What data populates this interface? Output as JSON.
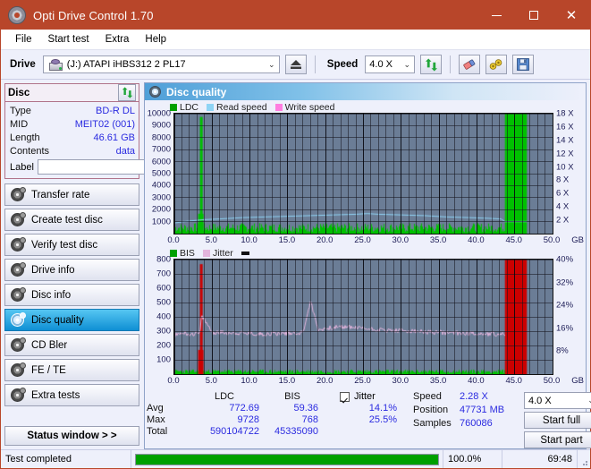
{
  "window": {
    "title": "Opti Drive Control 1.70",
    "icon": "disc-icon",
    "minimize": "–",
    "maximize": "□",
    "close": "✕"
  },
  "menubar": {
    "items": [
      "File",
      "Start test",
      "Extra",
      "Help"
    ]
  },
  "toolbar": {
    "drive_label": "Drive",
    "drive_value": "(J:)   ATAPI iHBS312  2 PL17",
    "eject_title": "eject-button",
    "speed_label": "Speed",
    "speed_value": "4.0 X",
    "buttons": [
      {
        "name": "refresh-icon",
        "glyph": "refresh"
      },
      {
        "name": "erase-icon",
        "glyph": "eraser"
      },
      {
        "name": "quick-erase-icon",
        "glyph": "wrench"
      },
      {
        "name": "save-icon",
        "glyph": "floppy"
      }
    ]
  },
  "disc_panel": {
    "title": "Disc",
    "refresh_icon": "refresh-icon",
    "rows": [
      {
        "key": "Type",
        "value": "BD-R DL"
      },
      {
        "key": "MID",
        "value": "MEIT02 (001)"
      },
      {
        "key": "Length",
        "value": "46.61 GB"
      },
      {
        "key": "Contents",
        "value": "data"
      }
    ],
    "label_key": "Label",
    "label_value": "",
    "label_placeholder": "",
    "label_button_icon": "disc-icon"
  },
  "sidebar": {
    "items": [
      {
        "label": "Transfer rate",
        "active": false
      },
      {
        "label": "Create test disc",
        "active": false
      },
      {
        "label": "Verify test disc",
        "active": false
      },
      {
        "label": "Drive info",
        "active": false
      },
      {
        "label": "Disc info",
        "active": false
      },
      {
        "label": "Disc quality",
        "active": true
      },
      {
        "label": "CD Bler",
        "active": false
      },
      {
        "label": "FE / TE",
        "active": false
      },
      {
        "label": "Extra tests",
        "active": false
      }
    ],
    "status_window": "Status window > >"
  },
  "quality_panel": {
    "title": "Disc quality",
    "icon": "disc-quality-icon"
  },
  "stats": {
    "col_headers": [
      "LDC",
      "BIS"
    ],
    "jitter_label": "Jitter",
    "jitter_checked": true,
    "rows": [
      {
        "key": "Avg",
        "ldc": "772.69",
        "bis": "59.36",
        "jitter": "14.1%"
      },
      {
        "key": "Max",
        "ldc": "9728",
        "bis": "768",
        "jitter": "25.5%"
      },
      {
        "key": "Total",
        "ldc": "590104722",
        "bis": "45335090",
        "jitter": ""
      }
    ]
  },
  "readout": {
    "speed_key": "Speed",
    "speed_value": "2.28 X",
    "speed_select": "4.0 X",
    "position_key": "Position",
    "position_value": "47731 MB",
    "samples_key": "Samples",
    "samples_value": "760086",
    "start_full": "Start full",
    "start_part": "Start part"
  },
  "statusbar": {
    "message": "Test completed",
    "percent_text": "100.0%",
    "percent_value": 100,
    "elapsed": "69:48"
  },
  "colors": {
    "ldc": "#00c000",
    "bis": "#00c000",
    "read_speed": "#8fd4f5",
    "write_speed": "#ff7ee0",
    "jitter": "#e3b4dc",
    "bis_saturated": "#cc0000",
    "plot_bg": "#6b7d96",
    "accent": "#b8462a",
    "value_text": "#2b2be0"
  },
  "chart_data": [
    {
      "type": "line",
      "name": "ldc-chart",
      "title": "Disc quality",
      "xlabel": "GB",
      "ylabel": "LDC",
      "xlim": [
        0,
        50
      ],
      "ylim": [
        0,
        10000
      ],
      "y2lim": [
        0,
        18
      ],
      "y2label": "X",
      "xticks": [
        0.0,
        5.0,
        10.0,
        15.0,
        20.0,
        25.0,
        30.0,
        35.0,
        40.0,
        45.0,
        50.0
      ],
      "xtick_labels": [
        "0.0",
        "5.0",
        "10.0",
        "15.0",
        "20.0",
        "25.0",
        "30.0",
        "35.0",
        "40.0",
        "45.0",
        "50.0"
      ],
      "xunit": "GB",
      "yticks": [
        1000,
        2000,
        3000,
        4000,
        5000,
        6000,
        7000,
        8000,
        9000,
        10000
      ],
      "ytick_labels": [
        "1000",
        "2000",
        "3000",
        "4000",
        "5000",
        "6000",
        "7000",
        "8000",
        "9000",
        "10000"
      ],
      "y2ticks": [
        2,
        4,
        6,
        8,
        10,
        12,
        14,
        16,
        18
      ],
      "y2tick_labels": [
        "2 X",
        "4 X",
        "6 X",
        "8 X",
        "10 X",
        "12 X",
        "14 X",
        "16 X",
        "18 X"
      ],
      "legend": [
        {
          "label": "LDC",
          "color": "#00a000"
        },
        {
          "label": "Read speed",
          "color": "#8fd4f5"
        },
        {
          "label": "Write speed",
          "color": "#ff7ee0"
        }
      ],
      "legend_position": "top-left",
      "grid": true,
      "series": [
        {
          "name": "LDC",
          "type": "bar",
          "color": "#00c000",
          "note": "dense low-level noise ~200-900 across disc; tall spike to 9728 at 3.5 GB; saturated full-height block 43.7-46.6 GB",
          "baseline_avg": 772.69,
          "spike": {
            "x": 3.5,
            "y": 9728
          },
          "saturated_block": {
            "x_start": 43.7,
            "x_end": 46.6,
            "y": 10000
          }
        },
        {
          "name": "Read speed",
          "type": "line",
          "color": "#8fd4f5",
          "axis": "right",
          "x": [
            0.0,
            2.0,
            4.0,
            6.0,
            9.0,
            12.0,
            15.0,
            18.0,
            21.0,
            24.0,
            25.5,
            27.0,
            30.0,
            33.0,
            36.0,
            39.0,
            41.5,
            43.2,
            43.7,
            46.6
          ],
          "values": [
            1.6,
            1.9,
            2.1,
            2.2,
            2.4,
            2.5,
            2.6,
            2.7,
            2.8,
            2.9,
            3.0,
            2.9,
            2.8,
            2.7,
            2.5,
            2.4,
            2.3,
            2.2,
            1.8,
            1.8
          ]
        },
        {
          "name": "Write speed",
          "type": "line",
          "color": "#ff7ee0",
          "axis": "right",
          "x": [],
          "values": []
        }
      ]
    },
    {
      "type": "line",
      "name": "bis-jitter-chart",
      "xlabel": "GB",
      "ylabel": "BIS",
      "xlim": [
        0,
        50
      ],
      "ylim": [
        0,
        800
      ],
      "y2lim": [
        0,
        40
      ],
      "y2label": "%",
      "xticks": [
        0.0,
        5.0,
        10.0,
        15.0,
        20.0,
        25.0,
        30.0,
        35.0,
        40.0,
        45.0,
        50.0
      ],
      "xtick_labels": [
        "0.0",
        "5.0",
        "10.0",
        "15.0",
        "20.0",
        "25.0",
        "30.0",
        "35.0",
        "40.0",
        "45.0",
        "50.0"
      ],
      "xunit": "GB",
      "yticks": [
        100,
        200,
        300,
        400,
        500,
        600,
        700,
        800
      ],
      "ytick_labels": [
        "100",
        "200",
        "300",
        "400",
        "500",
        "600",
        "700",
        "800"
      ],
      "y2ticks": [
        8,
        16,
        24,
        32,
        40
      ],
      "y2tick_labels": [
        "8%",
        "16%",
        "24%",
        "32%",
        "40%"
      ],
      "legend": [
        {
          "label": "BIS",
          "color": "#00a000"
        },
        {
          "label": "Jitter",
          "color": "#e3b4dc"
        }
      ],
      "legend_position": "top-left",
      "grid": true,
      "series": [
        {
          "name": "BIS",
          "type": "bar",
          "color": "#00c000",
          "note": "low green noise near baseline across disc; red spike to 768 at 3.5 GB; saturated red block 43.7-46.6 GB",
          "baseline_avg": 59.36,
          "spike": {
            "x": 3.5,
            "y": 768,
            "color": "#cc0000"
          },
          "saturated_block": {
            "x_start": 43.7,
            "x_end": 46.6,
            "y": 800,
            "color": "#cc0000"
          }
        },
        {
          "name": "Jitter",
          "type": "line",
          "color": "#e3b4dc",
          "axis": "right",
          "note": "noisy band around 14% average, spikes near 3.5 GB and 18 GB",
          "x": [
            0.0,
            1.0,
            2.0,
            3.4,
            3.6,
            5.0,
            8.0,
            11.0,
            14.0,
            17.0,
            18.0,
            19.0,
            21.0,
            23.0,
            25.0,
            28.0,
            31.0,
            34.0,
            37.0,
            40.0,
            42.0,
            43.5
          ],
          "values": [
            13.5,
            14.5,
            14.0,
            14.2,
            20.5,
            14.6,
            14.4,
            14.0,
            14.2,
            14.5,
            25.5,
            15.5,
            16.3,
            16.5,
            16.0,
            15.3,
            15.0,
            14.6,
            14.4,
            14.2,
            14.0,
            13.8
          ]
        }
      ]
    }
  ]
}
